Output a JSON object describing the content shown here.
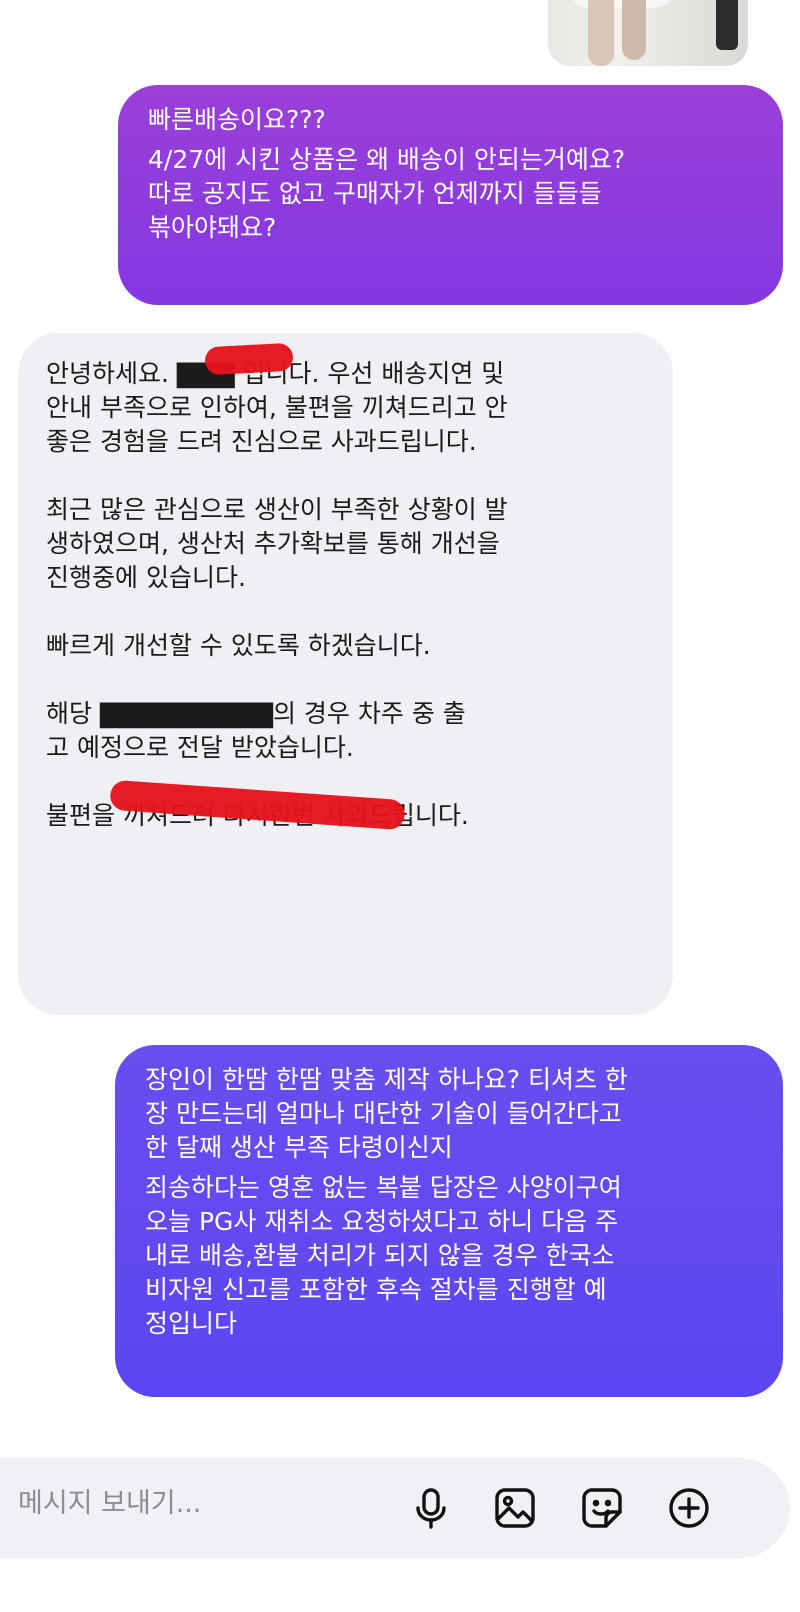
{
  "conversation": {
    "outgoing_1": {
      "lines": [
        "빠른배송이요???",
        "4/27에 시킨 상품은 왜 배송이 안되는거예요?\n따로 공지도 없고 구매자가 언제까지 들들들\n볶아야돼요?"
      ]
    },
    "incoming_1": {
      "paragraphs": [
        "안녕하세요. ▇▇▇ 입니다. 우선 배송지연 및\n안내 부족으로 인하여, 불편을 끼쳐드리고 안\n좋은 경험을 드려 진심으로 사과드립니다.",
        "최근 많은 관심으로 생산이 부족한 상황이 발\n생하였으며, 생산처 추가확보를 통해 개선을\n진행중에 있습니다.",
        "빠르게 개선할 수 있도록 하겠습니다.",
        "해당 ▇▇▇▇▇▇▇▇▇의 경우 차주 중 출\n고 예정으로 전달 받았습니다.",
        "불편을 끼쳐드려 다시한번 사과드립니다."
      ]
    },
    "outgoing_2": {
      "lines": [
        "장인이 한땀 한땀 맞춤 제작 하나요? 티셔츠 한\n장 만드는데 얼마나 대단한 기술이 들어간다고\n한 달째 생산 부족 타령이신지",
        "죄송하다는 영혼 없는 복붙 답장은 사양이구여\n오늘 PG사 재취소 요청하셨다고 하니 다음 주\n내로 배송,환불 처리가 되지 않을 경우 한국소\n비자원 신고를 포함한 후속 절차를 진행할 예\n정입니다"
      ]
    }
  },
  "composer": {
    "placeholder": "메시지 보내기...",
    "icons": [
      "microphone-icon",
      "image-icon",
      "sticker-icon",
      "add-icon"
    ]
  },
  "colors": {
    "outgoing_1_gradient": [
      "#9b3fd8",
      "#8338e2"
    ],
    "outgoing_2_gradient": [
      "#6a4df0",
      "#5b45f2"
    ],
    "incoming_background": "#eff0f3",
    "redaction": "#e6121c",
    "composer_background": "#f0f1f4"
  }
}
